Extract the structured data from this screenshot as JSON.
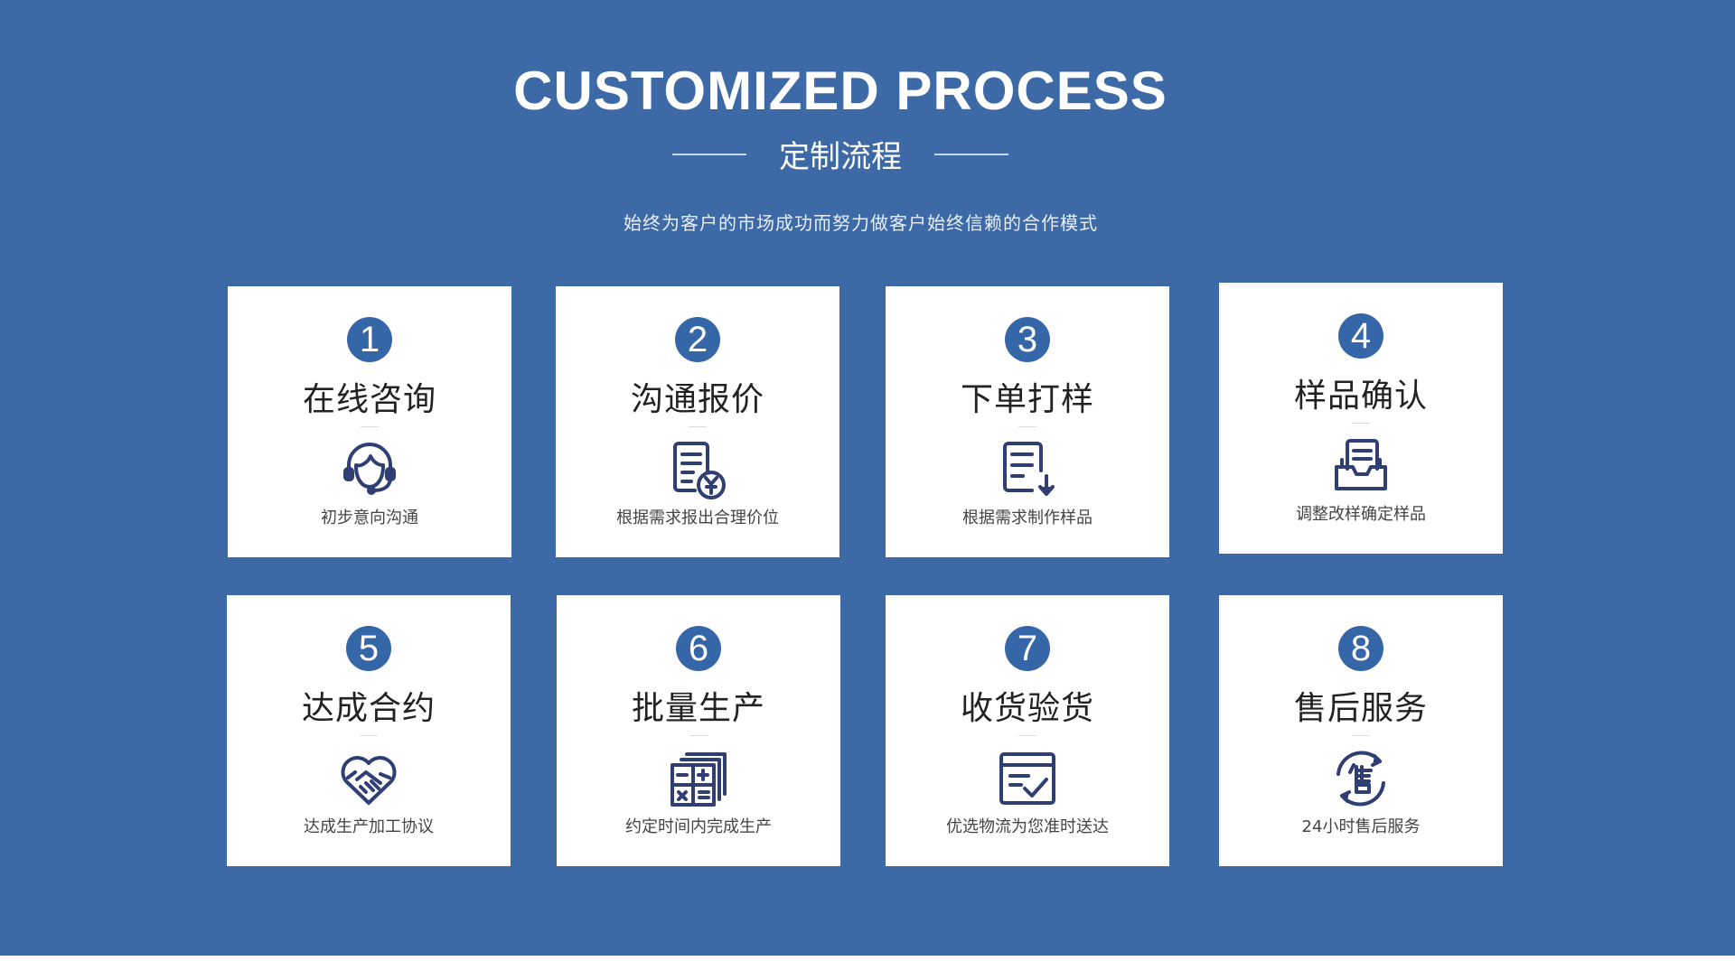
{
  "header": {
    "title": "CUSTOMIZED PROCESS",
    "subtitle": "定制流程",
    "tagline": "始终为客户的市场成功而努力做客户始终信赖的合作模式"
  },
  "colors": {
    "background": "#3d6aa6",
    "badge": "#3566a8",
    "icon": "#2f3f74",
    "card": "#ffffff"
  },
  "steps": [
    {
      "number": "1",
      "title": "在线咨询",
      "desc": "初步意向沟通",
      "icon": "headset-agent-icon"
    },
    {
      "number": "2",
      "title": "沟通报价",
      "desc": "根据需求报出合理价位",
      "icon": "quote-document-yen-icon"
    },
    {
      "number": "3",
      "title": "下单打样",
      "desc": "根据需求制作样品",
      "icon": "document-download-icon"
    },
    {
      "number": "4",
      "title": "样品确认",
      "desc": "调整改样确定样品",
      "icon": "inbox-document-icon"
    },
    {
      "number": "5",
      "title": "达成合约",
      "desc": "达成生产加工协议",
      "icon": "handshake-heart-icon"
    },
    {
      "number": "6",
      "title": "批量生产",
      "desc": "约定时间内完成生产",
      "icon": "calculator-stack-icon"
    },
    {
      "number": "7",
      "title": "收货验货",
      "desc": "优选物流为您准时送达",
      "icon": "checked-box-icon"
    },
    {
      "number": "8",
      "title": "售后服务",
      "desc": "24小时售后服务",
      "icon": "after-sales-cycle-icon"
    }
  ]
}
